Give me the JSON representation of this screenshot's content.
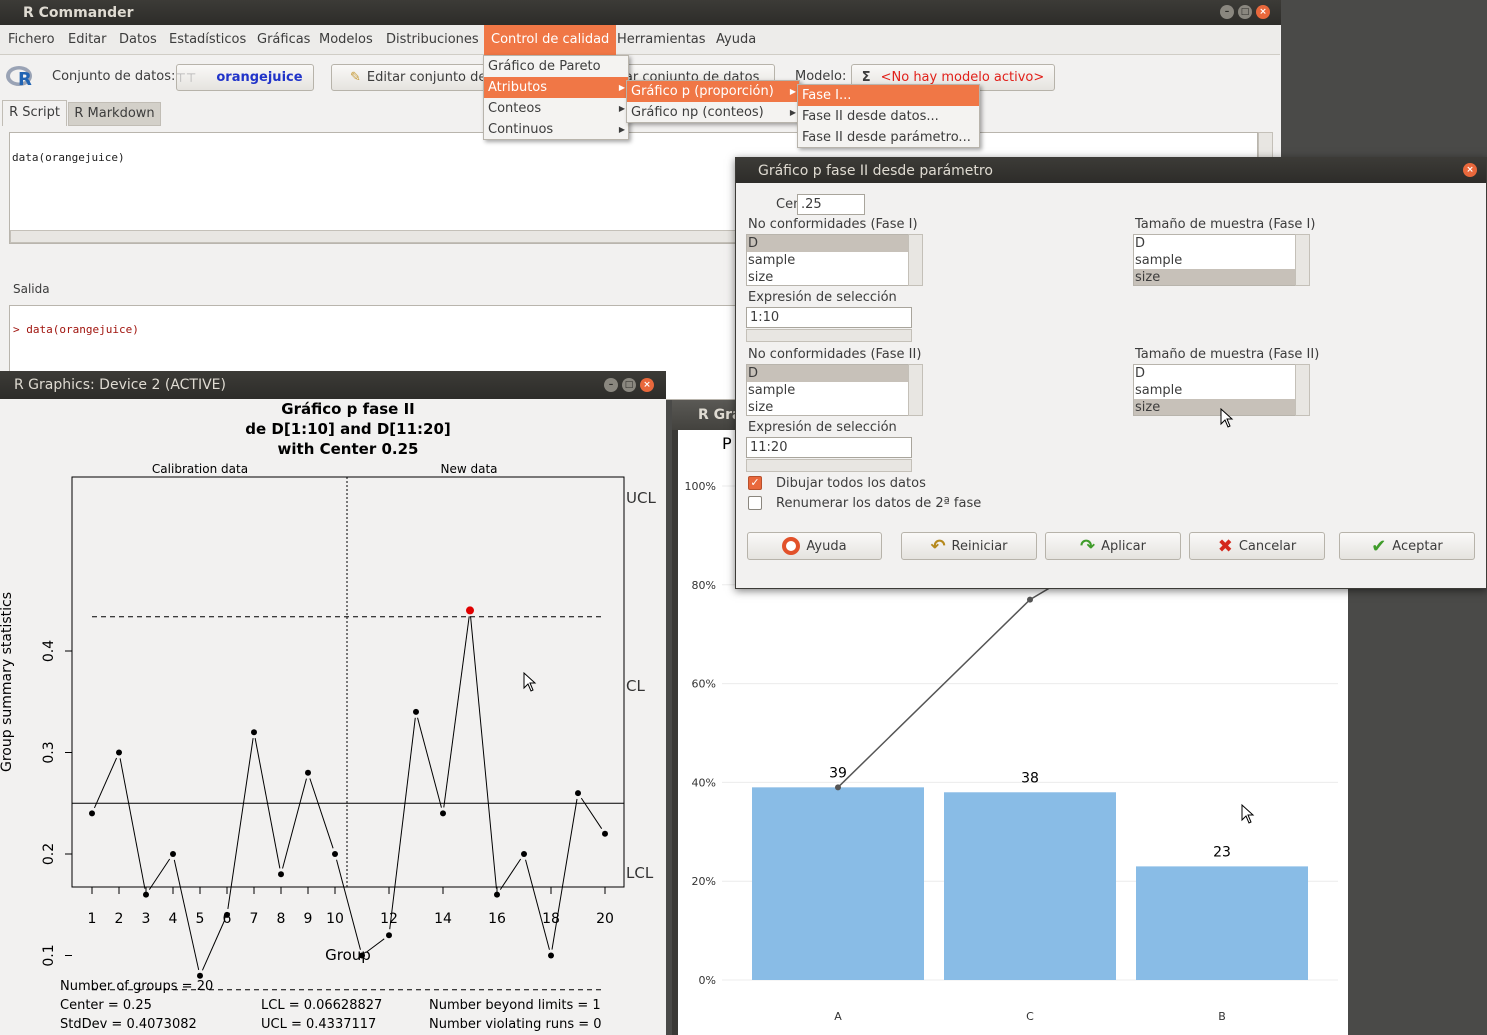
{
  "rcmdr": {
    "title": "R Commander",
    "menu": [
      "Fichero",
      "Editar",
      "Datos",
      "Estadísticos",
      "Gráficas",
      "Modelos",
      "Distribuciones",
      "Control de calidad",
      "Herramientas",
      "Ayuda"
    ],
    "dataset_label": "Conjunto de datos:",
    "dataset": "orangejuice",
    "edit_btn": "Editar conjunto de datos",
    "view_btn": "Visualizar conjunto de datos",
    "model_label": "Modelo:",
    "model": "<No hay modelo activo>",
    "tabs": [
      "R Script",
      "R Markdown"
    ],
    "script": "data(orangejuice)",
    "output_label": "Salida",
    "output": "> data(orangejuice)"
  },
  "menus": {
    "qc": [
      "Gráfico de Pareto",
      "Atributos",
      "Conteos",
      "Continuos"
    ],
    "attr": [
      "Gráfico p (proporción)",
      "Gráfico np (conteos)"
    ],
    "pchart": [
      "Fase I...",
      "Fase II desde datos...",
      "Fase II desde parámetro..."
    ]
  },
  "dialog": {
    "title": "Gráfico p fase II desde parámetro",
    "center_label": "Centro",
    "center_value": ".25",
    "nc1_label": "No conformidades (Fase I)",
    "ss1_label": "Tamaño de muestra (Fase I)",
    "nc2_label": "No conformidades (Fase II)",
    "ss2_label": "Tamaño de muestra (Fase II)",
    "vars": [
      "D",
      "sample",
      "size"
    ],
    "sel1_label": "Expresión de selección",
    "sel1_value": "1:10",
    "sel2_label": "Expresión de selección",
    "sel2_value": "11:20",
    "draw_all": "Dibujar todos los datos",
    "renumber": "Renumerar los datos de 2ª fase",
    "buttons": {
      "help": "Ayuda",
      "reset": "Reiniciar",
      "apply": "Aplicar",
      "cancel": "Cancelar",
      "ok": "Aceptar"
    }
  },
  "device2": {
    "title": "R Graphics: Device 2 (ACTIVE)"
  },
  "device3": {
    "title_partial": "R Gra",
    "title_letter": "P"
  },
  "pchart": {
    "title": [
      "Gráfico p fase II",
      "de D[1:10] and D[11:20]",
      "with Center 0.25"
    ],
    "calib": "Calibration data",
    "newdata": "New data",
    "ylabel": "Group summary statistics",
    "xlabel": "Group",
    "ucl_label": "UCL",
    "cl_label": "CL",
    "lcl_label": "LCL",
    "values": [
      0.24,
      0.3,
      0.16,
      0.2,
      0.08,
      0.14,
      0.32,
      0.18,
      0.28,
      0.2,
      0.1,
      0.12,
      0.34,
      0.24,
      0.44,
      0.16,
      0.2,
      0.1,
      0.26,
      0.22
    ],
    "center": 0.25,
    "ucl": 0.4337117,
    "lcl": 0.06628827,
    "yticks": [
      "0.1",
      "0.2",
      "0.3",
      "0.4"
    ],
    "xticks": [
      "1",
      "2",
      "3",
      "4",
      "5",
      "6",
      "7",
      "8",
      "9",
      "10",
      "12",
      "14",
      "16",
      "18",
      "20"
    ],
    "stats": {
      "groups": "Number of groups = 20",
      "center": "Center = 0.25",
      "stddev": "StdDev = 0.4073082",
      "lcl": "LCL = 0.06628827",
      "ucl": "UCL = 0.4337117",
      "beyond": "Number beyond limits = 1",
      "runs": "Number violating runs = 0"
    }
  },
  "chart_data": {
    "type": "bar",
    "categories": [
      "A",
      "C",
      "B"
    ],
    "values": [
      39,
      38,
      23
    ],
    "yticks": [
      "0%",
      "20%",
      "40%",
      "60%",
      "80%",
      "100%"
    ],
    "cumulative_visible": [
      39,
      77
    ]
  }
}
